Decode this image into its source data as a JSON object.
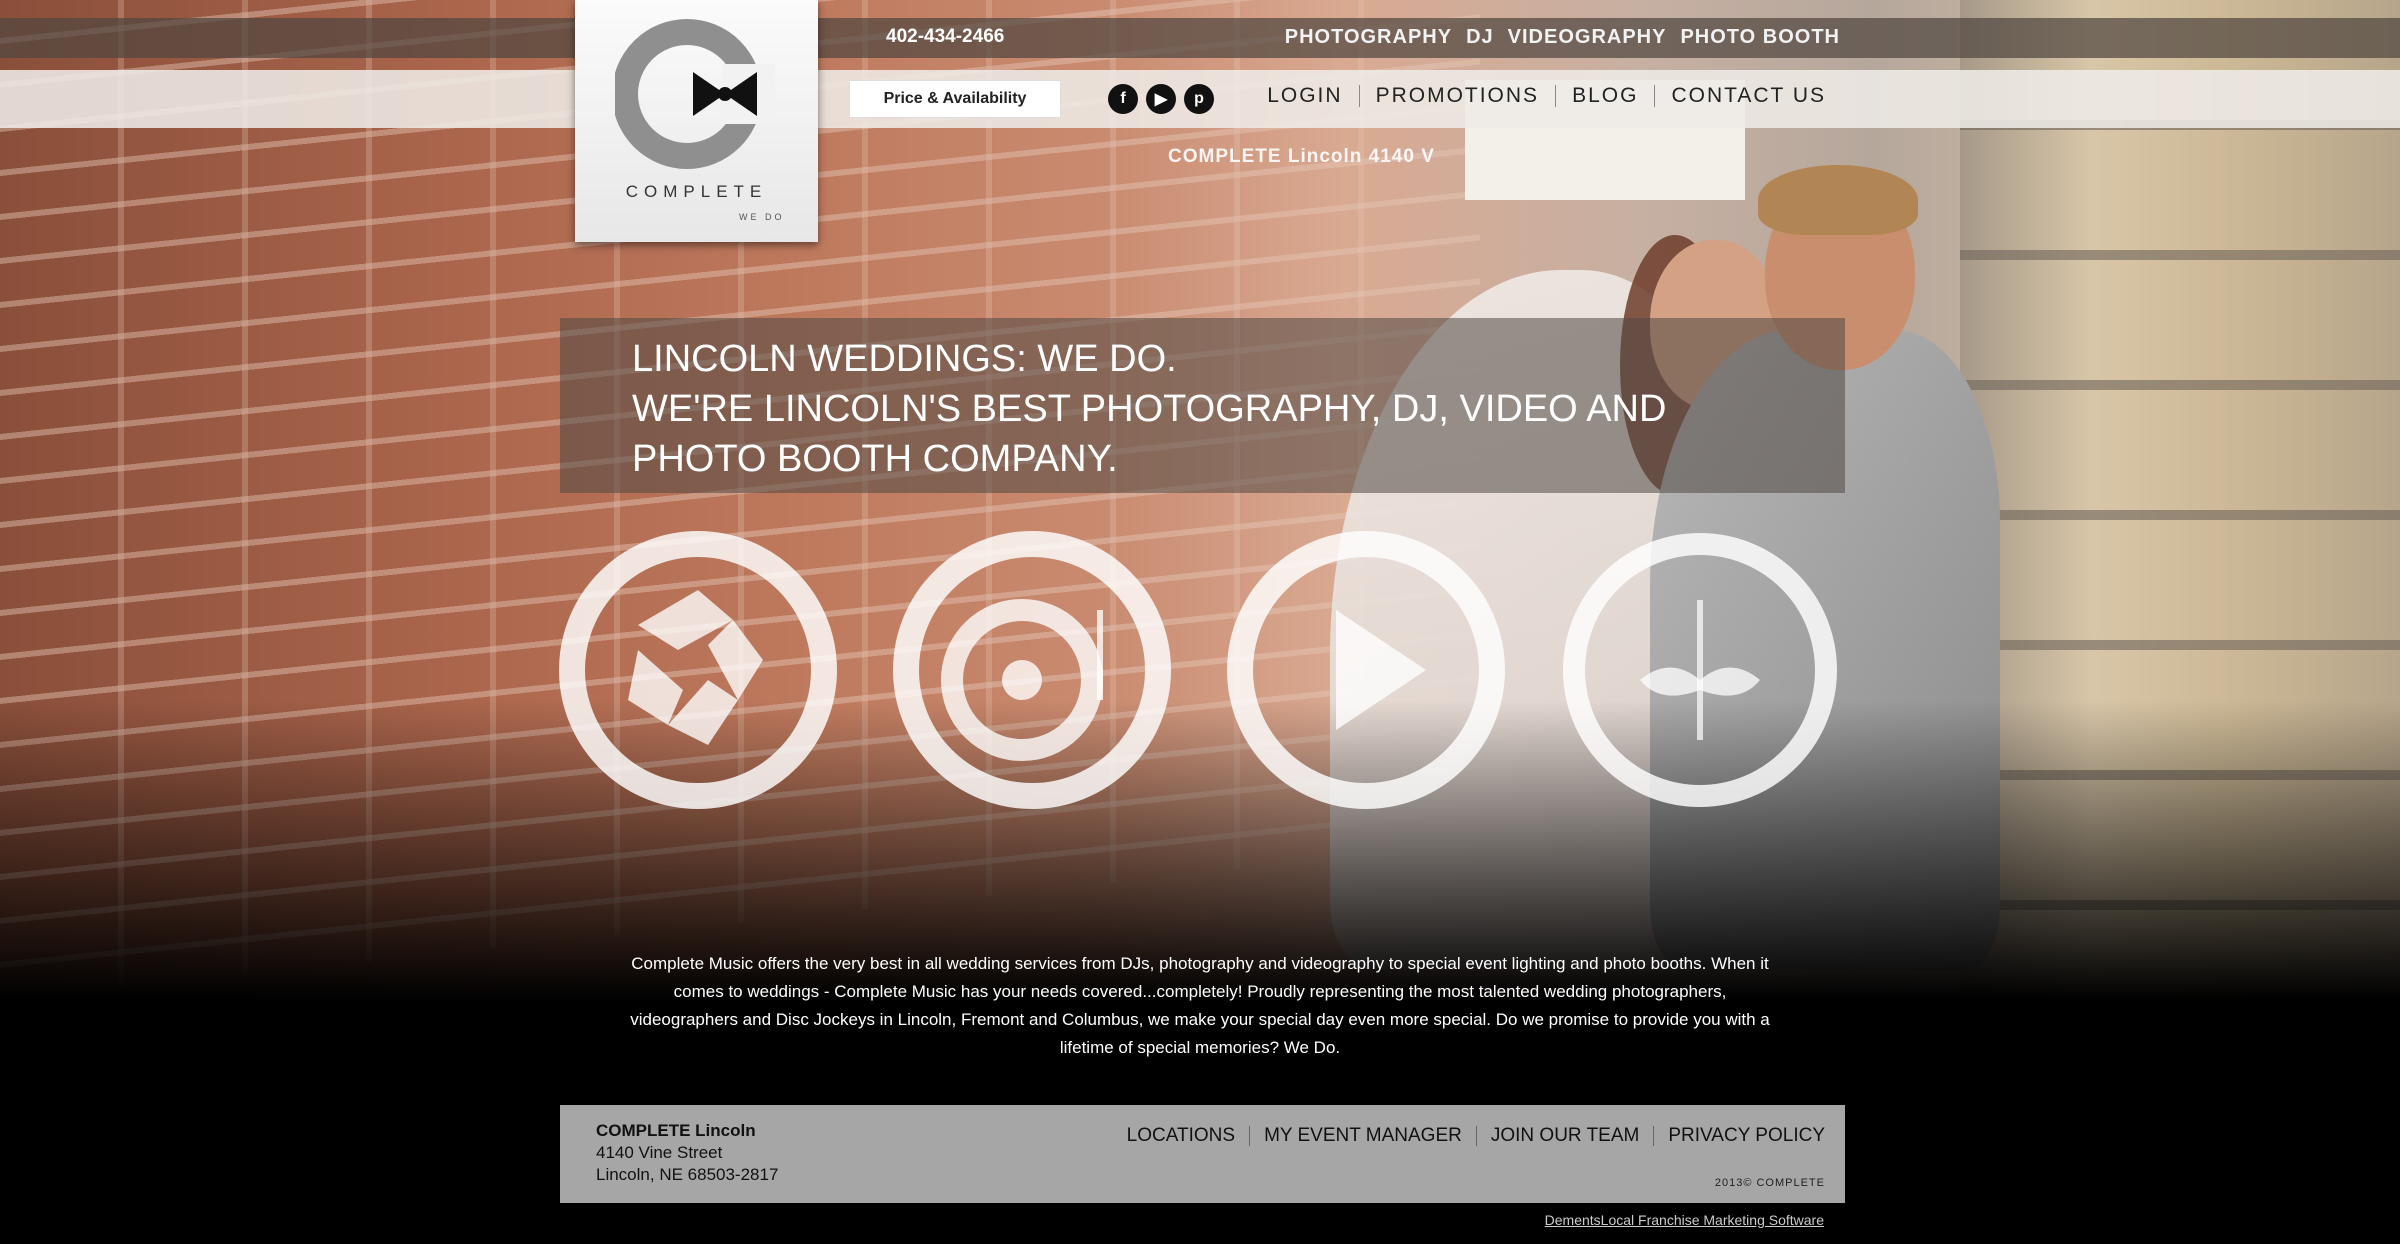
{
  "header": {
    "phone": "402-434-2466",
    "services": [
      "PHOTOGRAPHY",
      "DJ",
      "VIDEOGRAPHY",
      "PHOTO BOOTH"
    ],
    "price_button": "Price & Availability",
    "social": [
      {
        "icon": "facebook-icon",
        "glyph": "f"
      },
      {
        "icon": "youtube-icon",
        "glyph": "▶"
      },
      {
        "icon": "pinterest-icon",
        "glyph": "p"
      }
    ],
    "nav": [
      "LOGIN",
      "PROMOTIONS",
      "BLOG",
      "CONTACT US"
    ],
    "address_strip": "COMPLETE Lincoln 4140 V"
  },
  "logo": {
    "word": "COMPLETE",
    "tagline": "WE DO"
  },
  "hero": {
    "line1": "LINCOLN WEDDINGS: WE DO.",
    "line2": "WE'RE LINCOLN'S BEST PHOTOGRAPHY, DJ, VIDEO AND",
    "line3": "PHOTO BOOTH COMPANY.",
    "service_icons": [
      "camera-aperture-icon",
      "turntable-icon",
      "play-icon",
      "mustache-icon"
    ]
  },
  "intro": "Complete Music offers the very best in all wedding services from DJs, photography and videography to special event lighting and photo booths. When it comes to weddings - Complete Music has your needs covered...completely! Proudly representing the most talented wedding photographers, videographers and Disc Jockeys in Lincoln, Fremont and Columbus, we make your special day even more special. Do we promise to provide you with a lifetime of special memories? We Do.",
  "footer": {
    "name": "COMPLETE Lincoln",
    "address1": "4140 Vine Street",
    "address2": "Lincoln, NE 68503-2817",
    "links": [
      "LOCATIONS",
      "MY EVENT MANAGER",
      "JOIN OUR TEAM",
      "PRIVACY POLICY"
    ],
    "copyright": "2013© COMPLETE",
    "credit": "DementsLocal Franchise Marketing Software"
  }
}
